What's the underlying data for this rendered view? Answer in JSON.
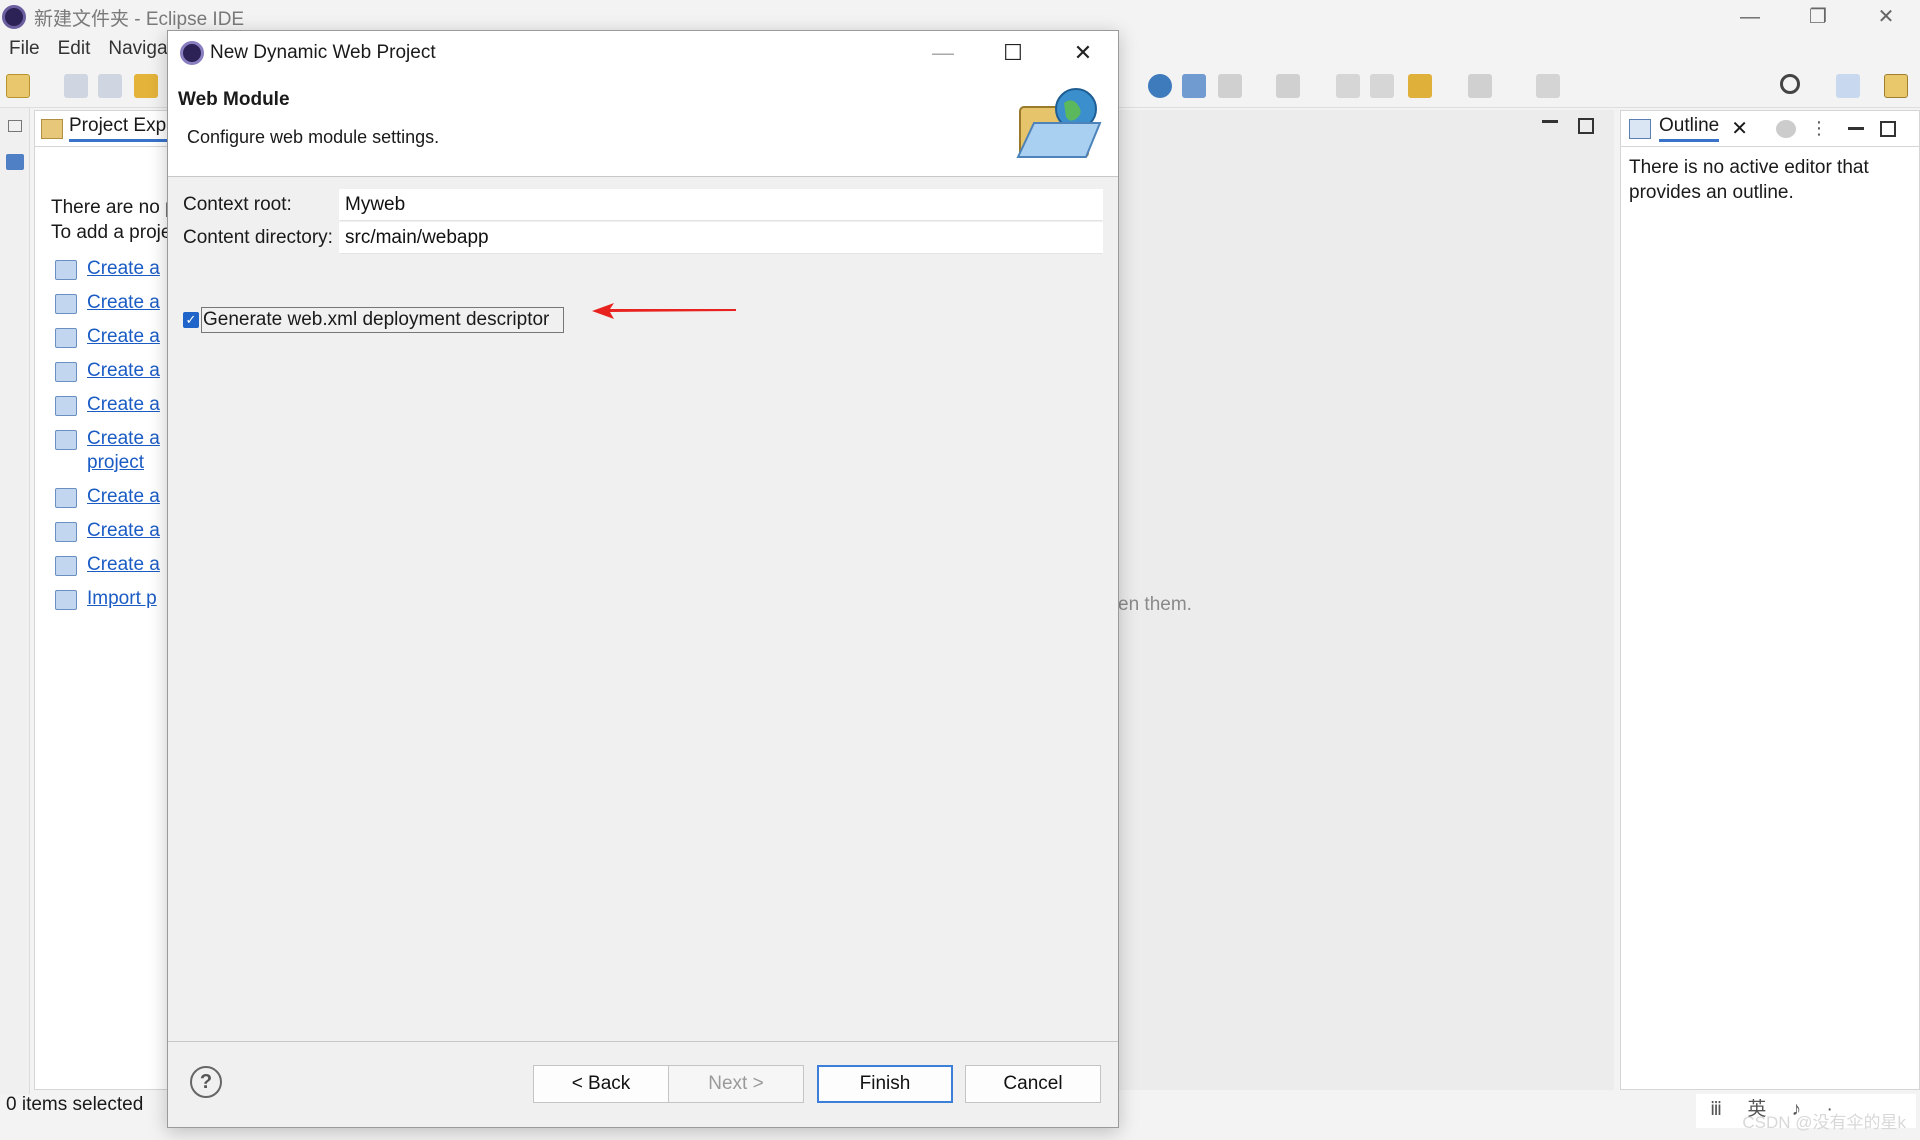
{
  "window": {
    "title": "新建文件夹 - Eclipse IDE",
    "controls": [
      "—",
      "❐",
      "✕"
    ]
  },
  "menu": [
    "File",
    "Edit",
    "Naviga"
  ],
  "explorer": {
    "tab_label": "Project Expl",
    "message_line1": "There are no p",
    "message_line2": "To add a proje",
    "links": [
      {
        "label": "Create a"
      },
      {
        "label": "Create a"
      },
      {
        "label": "Create a"
      },
      {
        "label": "Create a"
      },
      {
        "label": "Create a"
      },
      {
        "label": "Create a",
        "label2": "project"
      },
      {
        "label": "Create a"
      },
      {
        "label": "Create a"
      },
      {
        "label": "Create a"
      },
      {
        "label": "Import p"
      }
    ]
  },
  "editor": {
    "hint_text": "en them."
  },
  "outline": {
    "tab_label": "Outline",
    "message": "There is no active editor that provides an outline."
  },
  "status": {
    "text": "0 items selected",
    "watermark": "CSDN @没有伞的星k",
    "ime": "ⅲ 英 ♪ ·"
  },
  "dialog": {
    "title": "New Dynamic Web Project",
    "banner_title": "Web Module",
    "banner_desc": "Configure web module settings.",
    "context_root_label": "Context root:",
    "context_root_value": "Myweb",
    "content_dir_label": "Content directory:",
    "content_dir_value": "src/main/webapp",
    "checkbox_label": "Generate web.xml deployment descriptor",
    "checkbox_checked": true,
    "help_label": "?",
    "buttons": {
      "back": "< Back",
      "next": "Next >",
      "finish": "Finish",
      "cancel": "Cancel"
    },
    "controls": {
      "minimize": "—",
      "maximize": "☐",
      "close": "✕"
    }
  },
  "colors": {
    "accent_blue": "#1f64c8",
    "link_blue": "#1a5bc4",
    "annotation_arrow": "#e8231f"
  }
}
